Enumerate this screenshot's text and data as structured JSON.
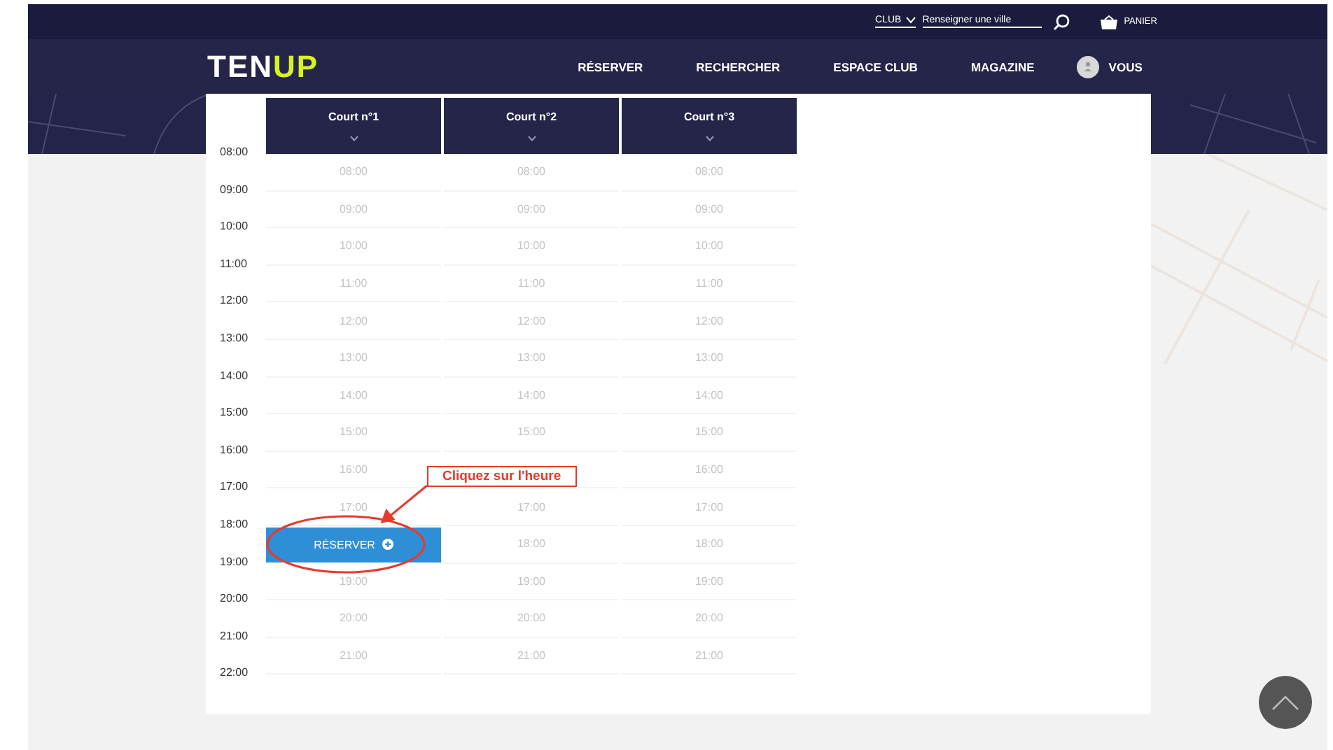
{
  "top_bar": {
    "club_label": "CLUB",
    "search": {
      "placeholder": "Renseigner une ville"
    },
    "cart_label": "PANIER"
  },
  "nav": {
    "logo": {
      "light": "TEN",
      "accent": "UP"
    },
    "links": [
      "RÉSERVER",
      "RECHERCHER",
      "ESPACE CLUB",
      "MAGAZINE"
    ],
    "account": "VOUS"
  },
  "hours": [
    "08:00",
    "09:00",
    "10:00",
    "11:00",
    "12:00",
    "13:00",
    "14:00",
    "15:00",
    "16:00",
    "17:00",
    "18:00",
    "19:00",
    "20:00",
    "21:00",
    "22:00"
  ],
  "courts": [
    {
      "name": "Court n°1",
      "slots": [
        {
          "kind": "time",
          "label": "08:00"
        },
        {
          "kind": "time",
          "label": "09:00"
        },
        {
          "kind": "time",
          "label": "10:00"
        },
        {
          "kind": "time",
          "label": "11:00"
        },
        {
          "kind": "time",
          "label": "12:00"
        },
        {
          "kind": "time",
          "label": "13:00"
        },
        {
          "kind": "time",
          "label": "14:00"
        },
        {
          "kind": "time",
          "label": "15:00"
        },
        {
          "kind": "time",
          "label": "16:00"
        },
        {
          "kind": "time",
          "label": "17:00"
        },
        {
          "kind": "button",
          "label": "RÉSERVER"
        },
        {
          "kind": "time",
          "label": "19:00"
        },
        {
          "kind": "time",
          "label": "20:00"
        },
        {
          "kind": "time",
          "label": "21:00"
        }
      ]
    },
    {
      "name": "Court n°2",
      "slots": [
        {
          "kind": "time",
          "label": "08:00"
        },
        {
          "kind": "time",
          "label": "09:00"
        },
        {
          "kind": "time",
          "label": "10:00"
        },
        {
          "kind": "time",
          "label": "11:00"
        },
        {
          "kind": "time",
          "label": "12:00"
        },
        {
          "kind": "time",
          "label": "13:00"
        },
        {
          "kind": "time",
          "label": "14:00"
        },
        {
          "kind": "time",
          "label": "15:00"
        },
        {
          "kind": "empty"
        },
        {
          "kind": "time",
          "label": "17:00"
        },
        {
          "kind": "time",
          "label": "18:00"
        },
        {
          "kind": "time",
          "label": "19:00"
        },
        {
          "kind": "time",
          "label": "20:00"
        },
        {
          "kind": "time",
          "label": "21:00"
        }
      ]
    },
    {
      "name": "Court n°3",
      "slots": [
        {
          "kind": "time",
          "label": "08:00"
        },
        {
          "kind": "time",
          "label": "09:00"
        },
        {
          "kind": "time",
          "label": "10:00"
        },
        {
          "kind": "time",
          "label": "11:00"
        },
        {
          "kind": "time",
          "label": "12:00"
        },
        {
          "kind": "time",
          "label": "13:00"
        },
        {
          "kind": "time",
          "label": "14:00"
        },
        {
          "kind": "time",
          "label": "15:00"
        },
        {
          "kind": "time",
          "label": "16:00"
        },
        {
          "kind": "time",
          "label": "17:00"
        },
        {
          "kind": "time",
          "label": "18:00"
        },
        {
          "kind": "time",
          "label": "19:00"
        },
        {
          "kind": "time",
          "label": "20:00"
        },
        {
          "kind": "time",
          "label": "21:00"
        }
      ]
    }
  ],
  "annotation": {
    "text": "Cliquez sur l'heure"
  }
}
